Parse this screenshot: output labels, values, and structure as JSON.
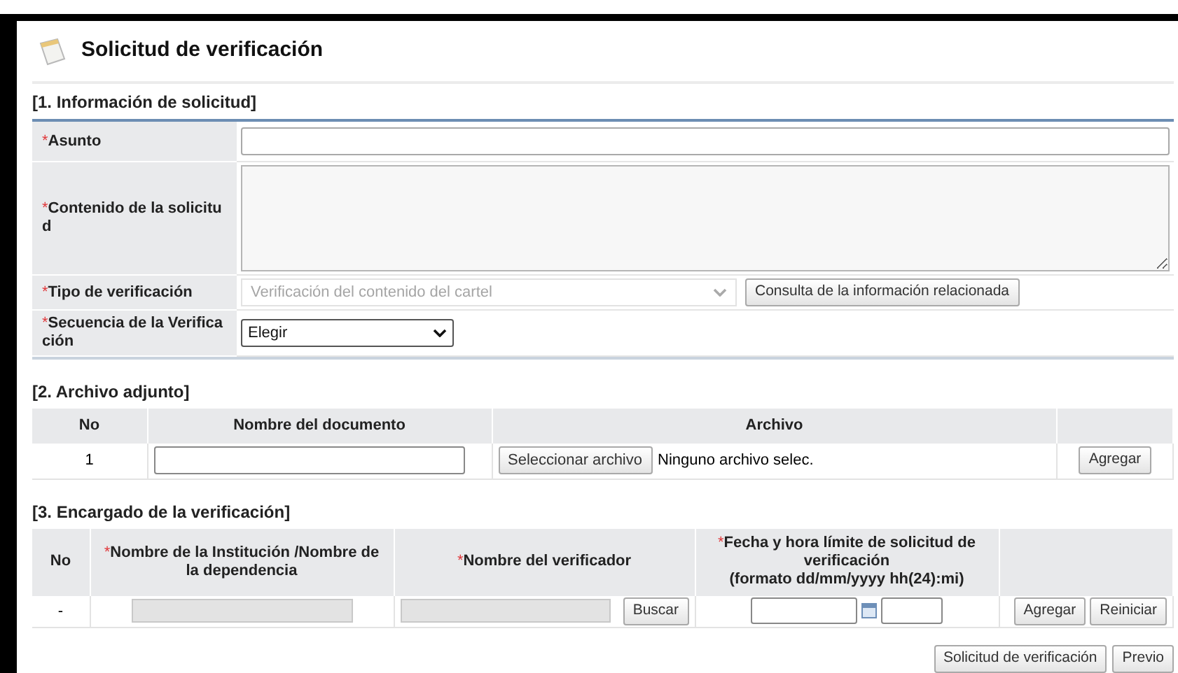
{
  "page_title": "Solicitud de verificación",
  "required_mark": "*",
  "request_info": {
    "heading": "[1. Información de solicitud]",
    "fields": [
      {
        "kind": "text",
        "label": "Asunto",
        "required": true
      },
      {
        "kind": "textarea",
        "label": "Contenido de la solicitud",
        "required": true
      },
      {
        "kind": "select",
        "label": "Tipo de verificación",
        "required": true,
        "value": "Verificación del contenido del cartel",
        "disabled": true,
        "button": "Consulta de la información relacionada"
      },
      {
        "kind": "select",
        "label": "Secuencia de la Verificación",
        "required": true,
        "value": "Elegir",
        "disabled": false
      }
    ]
  },
  "attachments": {
    "heading": "[2. Archivo adjunto]",
    "columns": [
      {
        "label": "No"
      },
      {
        "label": "Nombre del documento"
      },
      {
        "label": "Archivo"
      }
    ],
    "rows": [
      {
        "no": "1",
        "file_button": "Seleccionar archivo",
        "file_status": "Ninguno archivo selec.",
        "action": "Agregar"
      }
    ]
  },
  "verifiers": {
    "heading": "[3. Encargado de la verificación]",
    "columns": [
      {
        "label": "No",
        "required": false
      },
      {
        "label": "Nombre de la Institución /Nombre de la dependencia",
        "required": true
      },
      {
        "label": "Nombre del verificador",
        "required": true
      },
      {
        "label": "Fecha y hora límite de solicitud de verificación",
        "note": "(formato dd/mm/yyyy hh(24):mi)",
        "required": true
      }
    ],
    "rows": [
      {
        "no": "-",
        "search_button": "Buscar",
        "actions": [
          "Agregar",
          "Reiniciar"
        ]
      }
    ]
  },
  "footer_buttons": [
    "Solicitud de verificación",
    "Previo"
  ]
}
